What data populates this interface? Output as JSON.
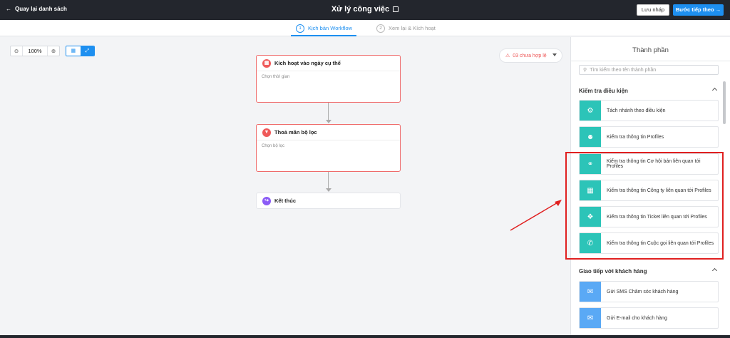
{
  "topbar": {
    "back_label": "Quay lại danh sách",
    "title": "Xử lý công việc",
    "draft_label": "Lưu nháp",
    "next_label": "Bước tiếp theo"
  },
  "steps": [
    {
      "num": "1",
      "label": "Kịch bản Workflow",
      "active": true
    },
    {
      "num": "2",
      "label": "Xem lại & Kích hoạt",
      "active": false
    }
  ],
  "canvas": {
    "zoom_value": "100%",
    "warning_label": "03 chưa hợp lệ",
    "nodes": [
      {
        "title": "Kích hoạt vào ngày cụ thể",
        "placeholder": "Chọn thời gian"
      },
      {
        "title": "Thoả mãn bộ lọc",
        "placeholder": "Chọn bộ lọc"
      },
      {
        "title": "Kết thúc"
      }
    ]
  },
  "panel": {
    "title": "Thành phần",
    "search_placeholder": "Tìm kiếm theo tên thành phần",
    "sections": [
      {
        "title": "Kiểm tra điều kiện",
        "items": [
          {
            "label": "Tách nhánh theo điều kiện",
            "icon": "branch-icon"
          },
          {
            "label": "Kiểm tra thông tin Profiles",
            "icon": "user-icon"
          },
          {
            "label": "Kiểm tra thông tin Cơ hội bán liên quan tới Profiles",
            "icon": "opportunity-icon"
          },
          {
            "label": "Kiểm tra thông tin Công ty liên quan tới Profiles",
            "icon": "company-icon"
          },
          {
            "label": "Kiểm tra thông tin Ticket liên quan tới Profiles",
            "icon": "ticket-icon"
          },
          {
            "label": "Kiểm tra thông tin Cuộc gọi liên quan tới Profiles",
            "icon": "phone-icon"
          }
        ]
      },
      {
        "title": "Giao tiếp với khách hàng",
        "items": [
          {
            "label": "Gửi SMS Chăm sóc khách hàng",
            "icon": "sms-icon"
          },
          {
            "label": "Gửi E-mail cho khách hàng",
            "icon": "email-icon"
          }
        ]
      }
    ]
  },
  "colors": {
    "accent": "#1d8ff0",
    "topbar": "#23262d",
    "node_border": "#ef6b6b",
    "teal": "#2cc4b8",
    "highlight": "#e02020"
  }
}
